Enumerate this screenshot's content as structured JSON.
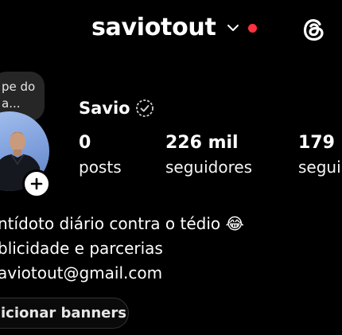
{
  "header": {
    "username": "saviotout",
    "chevron_icon": "chevron-down-icon",
    "notification_dot_color": "#ff3040",
    "threads_icon": "threads-icon"
  },
  "note": {
    "text": "pe do\na..."
  },
  "profile": {
    "display_name": "Savio",
    "verified_icon": "verified-badge-icon",
    "add_story_icon": "plus-icon"
  },
  "stats": [
    {
      "value": "0",
      "label": "posts"
    },
    {
      "value": "226 mil",
      "label": "seguidores"
    },
    {
      "value": "179",
      "label": "segui"
    }
  ],
  "bio": {
    "line1": "ntídoto diário contra o tédio 😂",
    "line2": "blicidade e parcerias",
    "line3": "aviotout@gmail.com"
  },
  "actions": {
    "banner_label": "icionar banners"
  }
}
